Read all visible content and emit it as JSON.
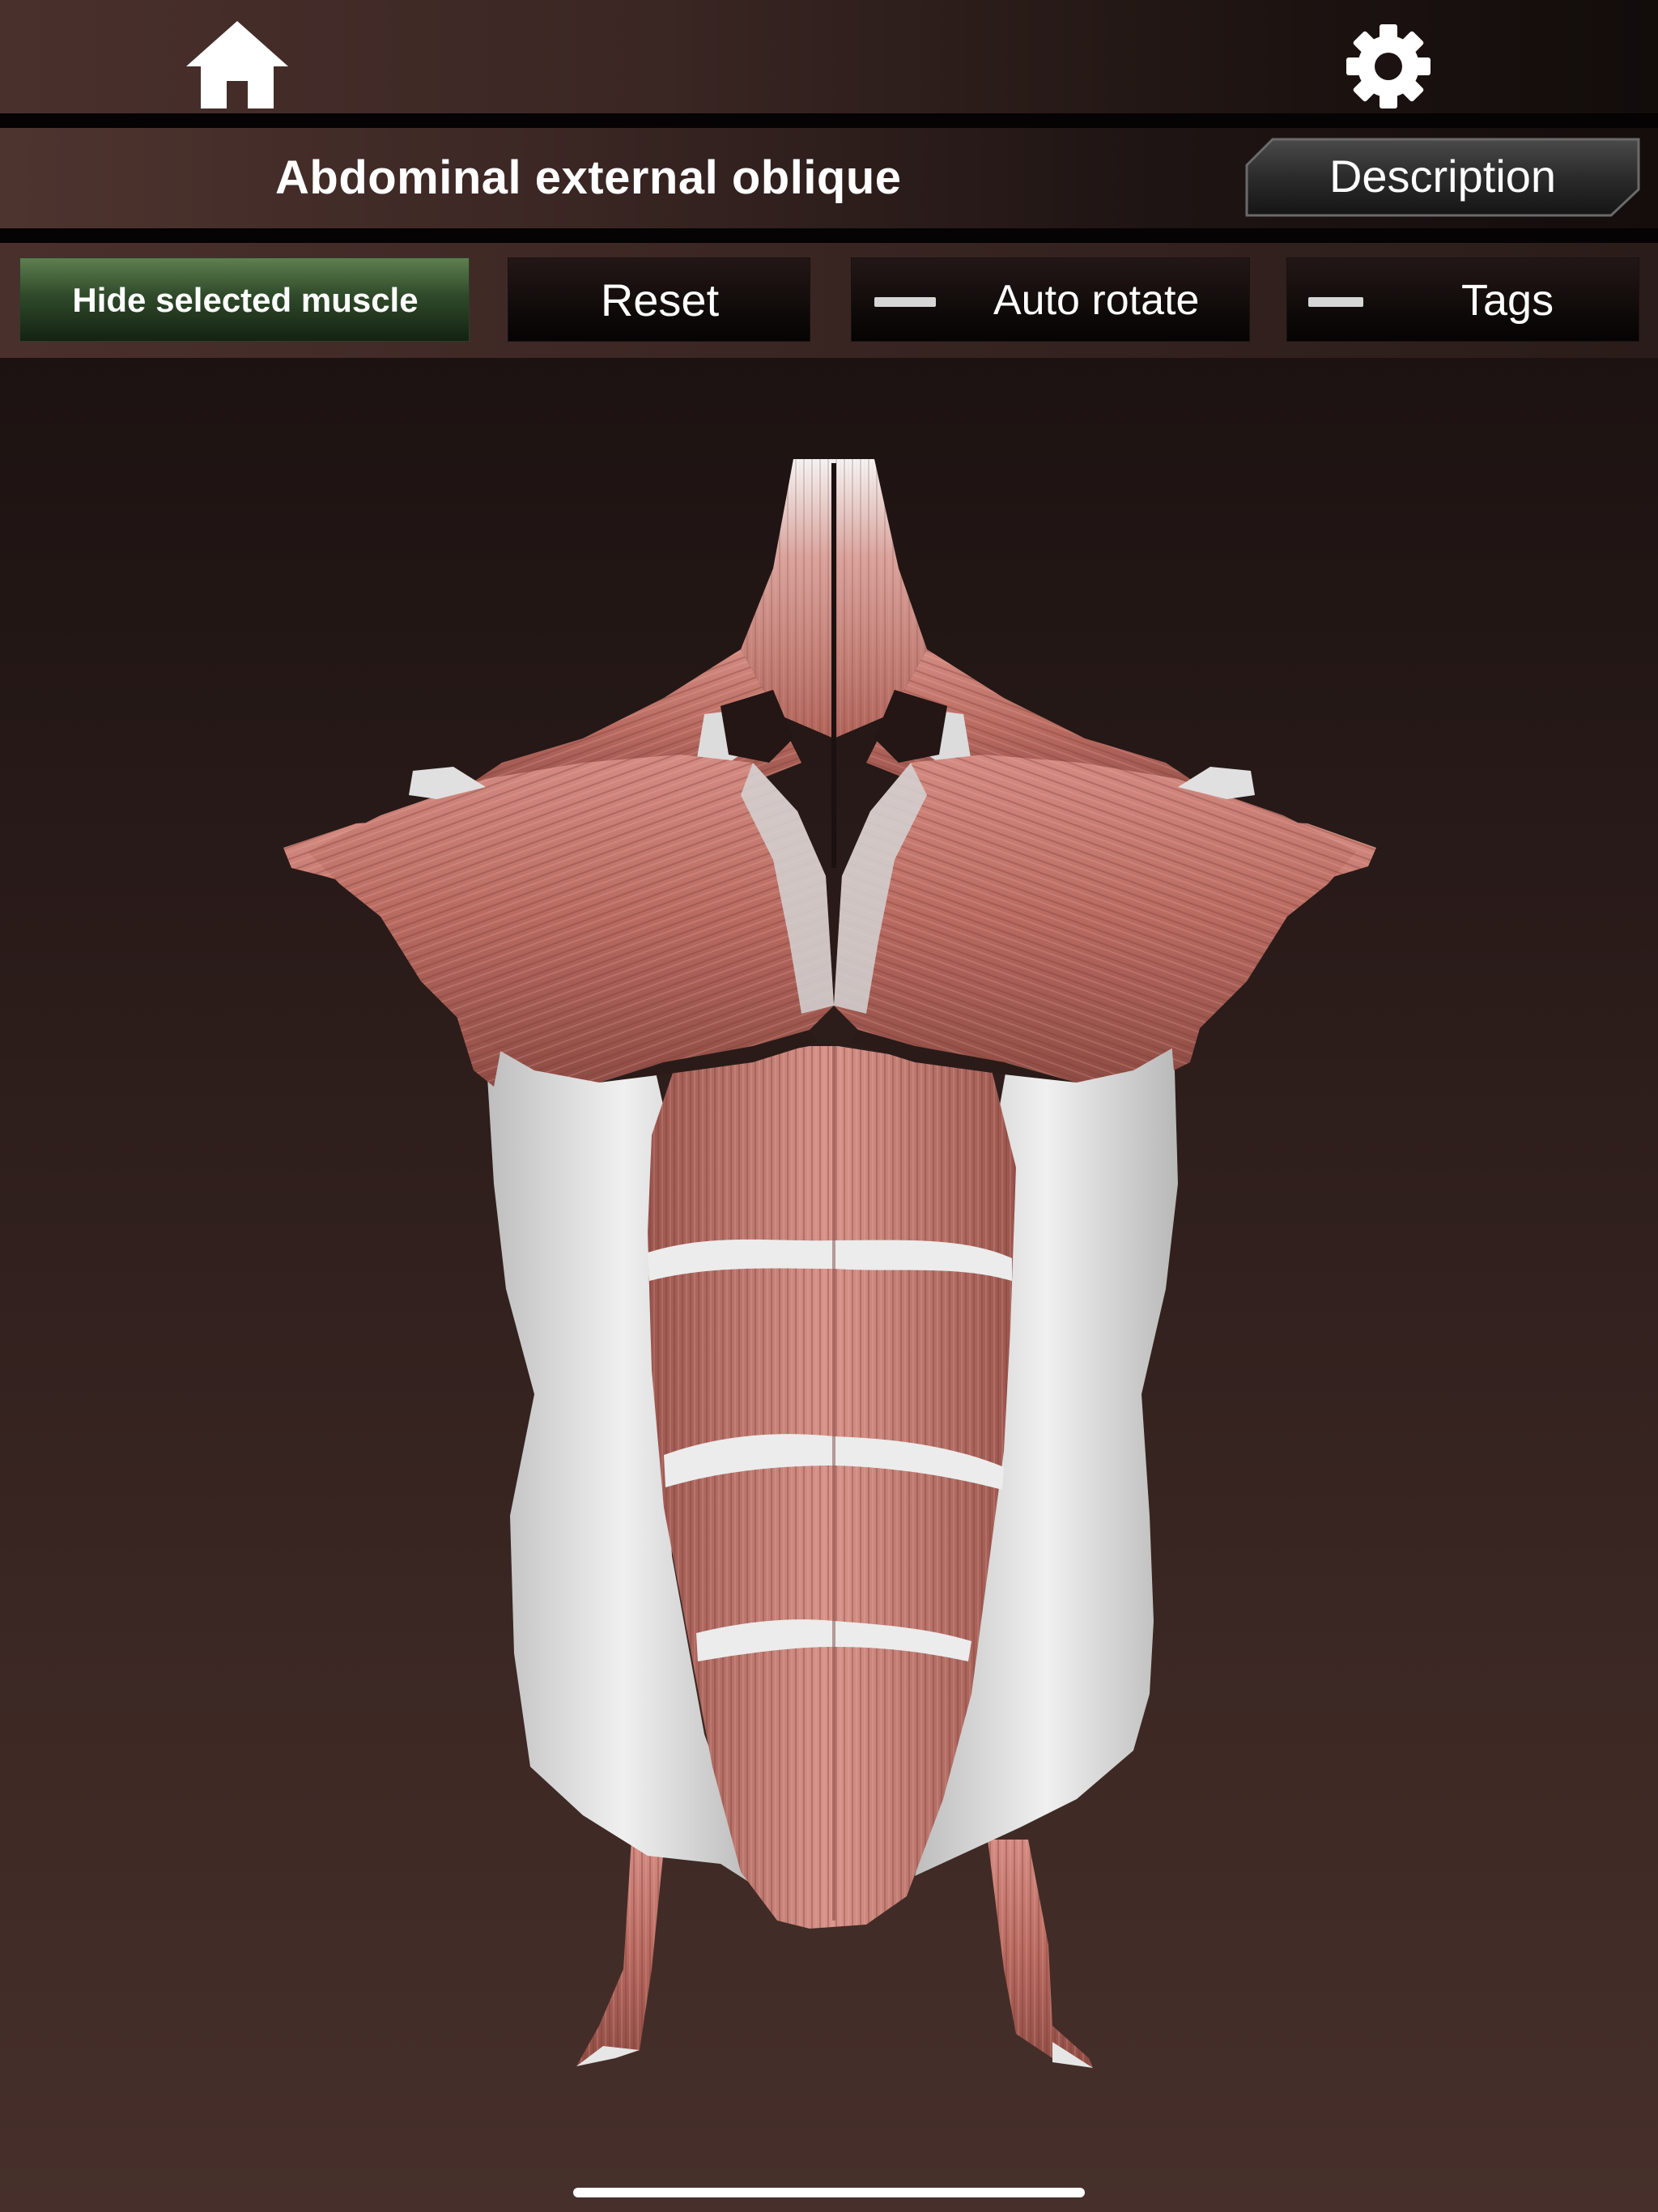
{
  "topbar": {
    "home_icon": "home-icon",
    "settings_icon": "gear-icon"
  },
  "titlebar": {
    "title": "Abdominal external oblique",
    "description_label": "Description"
  },
  "toolbar": {
    "hide_label": "Hide selected muscle",
    "reset_label": "Reset",
    "auto_rotate_label": "Auto rotate",
    "tags_label": "Tags"
  },
  "viewport": {
    "model": "anatomy-torso-muscles-3d-model",
    "selected_muscle": "Abdominal external oblique"
  },
  "colors": {
    "muscle": "#c47a70",
    "selected_muscle_highlight": "#e2e2e2",
    "hide_button_green": "#3b5a33"
  }
}
